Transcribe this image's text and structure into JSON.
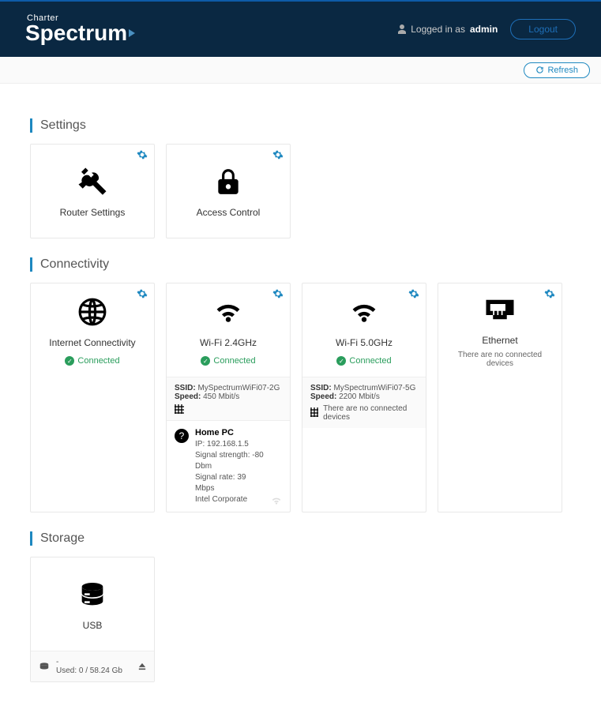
{
  "header": {
    "brand_top": "Charter",
    "brand_main": "Spectrum",
    "logged_in_prefix": "Logged in as",
    "username": "admin",
    "logout_label": "Logout",
    "refresh_label": "Refresh"
  },
  "sections": {
    "settings_title": "Settings",
    "connectivity_title": "Connectivity",
    "storage_title": "Storage"
  },
  "cards": {
    "router_settings": {
      "label": "Router Settings"
    },
    "access_control": {
      "label": "Access Control"
    },
    "internet": {
      "label": "Internet Connectivity",
      "status": "Connected"
    },
    "wifi24": {
      "label": "Wi-Fi 2.4GHz",
      "status": "Connected",
      "ssid_label": "SSID:",
      "ssid": "MySpectrumWiFi07-2G",
      "speed_label": "Speed:",
      "speed": "450 Mbit/s",
      "device": {
        "name": "Home PC",
        "ip_label": "IP:",
        "ip": "192.168.1.5",
        "signal_strength_label": "Signal strength:",
        "signal_strength": "-80 Dbm",
        "signal_rate_label": "Signal rate:",
        "signal_rate": "39 Mbps",
        "vendor": "Intel Corporate"
      }
    },
    "wifi50": {
      "label": "Wi-Fi 5.0GHz",
      "status": "Connected",
      "ssid_label": "SSID:",
      "ssid": "MySpectrumWiFi07-5G",
      "speed_label": "Speed:",
      "speed": "2200 Mbit/s",
      "no_devices": "There are no connected devices"
    },
    "ethernet": {
      "label": "Ethernet",
      "no_devices": "There are no connected devices"
    },
    "usb": {
      "label": "USB",
      "name": "-",
      "used_label": "Used:",
      "used": "0 / 58.24 Gb"
    }
  }
}
